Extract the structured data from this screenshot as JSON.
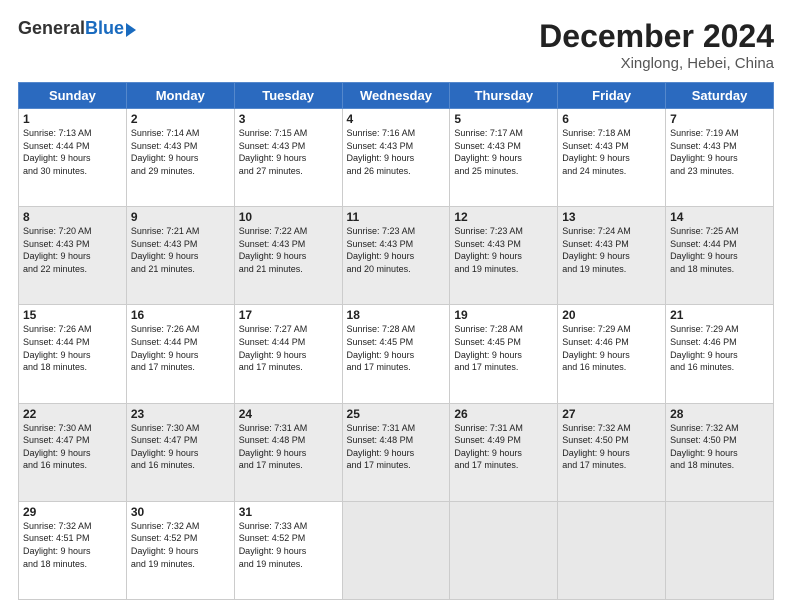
{
  "logo": {
    "general": "General",
    "blue": "Blue"
  },
  "title": "December 2024",
  "location": "Xinglong, Hebei, China",
  "days_of_week": [
    "Sunday",
    "Monday",
    "Tuesday",
    "Wednesday",
    "Thursday",
    "Friday",
    "Saturday"
  ],
  "weeks": [
    [
      {
        "day": "1",
        "info": "Sunrise: 7:13 AM\nSunset: 4:44 PM\nDaylight: 9 hours\nand 30 minutes."
      },
      {
        "day": "2",
        "info": "Sunrise: 7:14 AM\nSunset: 4:43 PM\nDaylight: 9 hours\nand 29 minutes."
      },
      {
        "day": "3",
        "info": "Sunrise: 7:15 AM\nSunset: 4:43 PM\nDaylight: 9 hours\nand 27 minutes."
      },
      {
        "day": "4",
        "info": "Sunrise: 7:16 AM\nSunset: 4:43 PM\nDaylight: 9 hours\nand 26 minutes."
      },
      {
        "day": "5",
        "info": "Sunrise: 7:17 AM\nSunset: 4:43 PM\nDaylight: 9 hours\nand 25 minutes."
      },
      {
        "day": "6",
        "info": "Sunrise: 7:18 AM\nSunset: 4:43 PM\nDaylight: 9 hours\nand 24 minutes."
      },
      {
        "day": "7",
        "info": "Sunrise: 7:19 AM\nSunset: 4:43 PM\nDaylight: 9 hours\nand 23 minutes."
      }
    ],
    [
      {
        "day": "8",
        "info": "Sunrise: 7:20 AM\nSunset: 4:43 PM\nDaylight: 9 hours\nand 22 minutes."
      },
      {
        "day": "9",
        "info": "Sunrise: 7:21 AM\nSunset: 4:43 PM\nDaylight: 9 hours\nand 21 minutes."
      },
      {
        "day": "10",
        "info": "Sunrise: 7:22 AM\nSunset: 4:43 PM\nDaylight: 9 hours\nand 21 minutes."
      },
      {
        "day": "11",
        "info": "Sunrise: 7:23 AM\nSunset: 4:43 PM\nDaylight: 9 hours\nand 20 minutes."
      },
      {
        "day": "12",
        "info": "Sunrise: 7:23 AM\nSunset: 4:43 PM\nDaylight: 9 hours\nand 19 minutes."
      },
      {
        "day": "13",
        "info": "Sunrise: 7:24 AM\nSunset: 4:43 PM\nDaylight: 9 hours\nand 19 minutes."
      },
      {
        "day": "14",
        "info": "Sunrise: 7:25 AM\nSunset: 4:44 PM\nDaylight: 9 hours\nand 18 minutes."
      }
    ],
    [
      {
        "day": "15",
        "info": "Sunrise: 7:26 AM\nSunset: 4:44 PM\nDaylight: 9 hours\nand 18 minutes."
      },
      {
        "day": "16",
        "info": "Sunrise: 7:26 AM\nSunset: 4:44 PM\nDaylight: 9 hours\nand 17 minutes."
      },
      {
        "day": "17",
        "info": "Sunrise: 7:27 AM\nSunset: 4:44 PM\nDaylight: 9 hours\nand 17 minutes."
      },
      {
        "day": "18",
        "info": "Sunrise: 7:28 AM\nSunset: 4:45 PM\nDaylight: 9 hours\nand 17 minutes."
      },
      {
        "day": "19",
        "info": "Sunrise: 7:28 AM\nSunset: 4:45 PM\nDaylight: 9 hours\nand 17 minutes."
      },
      {
        "day": "20",
        "info": "Sunrise: 7:29 AM\nSunset: 4:46 PM\nDaylight: 9 hours\nand 16 minutes."
      },
      {
        "day": "21",
        "info": "Sunrise: 7:29 AM\nSunset: 4:46 PM\nDaylight: 9 hours\nand 16 minutes."
      }
    ],
    [
      {
        "day": "22",
        "info": "Sunrise: 7:30 AM\nSunset: 4:47 PM\nDaylight: 9 hours\nand 16 minutes."
      },
      {
        "day": "23",
        "info": "Sunrise: 7:30 AM\nSunset: 4:47 PM\nDaylight: 9 hours\nand 16 minutes."
      },
      {
        "day": "24",
        "info": "Sunrise: 7:31 AM\nSunset: 4:48 PM\nDaylight: 9 hours\nand 17 minutes."
      },
      {
        "day": "25",
        "info": "Sunrise: 7:31 AM\nSunset: 4:48 PM\nDaylight: 9 hours\nand 17 minutes."
      },
      {
        "day": "26",
        "info": "Sunrise: 7:31 AM\nSunset: 4:49 PM\nDaylight: 9 hours\nand 17 minutes."
      },
      {
        "day": "27",
        "info": "Sunrise: 7:32 AM\nSunset: 4:50 PM\nDaylight: 9 hours\nand 17 minutes."
      },
      {
        "day": "28",
        "info": "Sunrise: 7:32 AM\nSunset: 4:50 PM\nDaylight: 9 hours\nand 18 minutes."
      }
    ],
    [
      {
        "day": "29",
        "info": "Sunrise: 7:32 AM\nSunset: 4:51 PM\nDaylight: 9 hours\nand 18 minutes."
      },
      {
        "day": "30",
        "info": "Sunrise: 7:32 AM\nSunset: 4:52 PM\nDaylight: 9 hours\nand 19 minutes."
      },
      {
        "day": "31",
        "info": "Sunrise: 7:33 AM\nSunset: 4:52 PM\nDaylight: 9 hours\nand 19 minutes."
      },
      {
        "day": "",
        "info": ""
      },
      {
        "day": "",
        "info": ""
      },
      {
        "day": "",
        "info": ""
      },
      {
        "day": "",
        "info": ""
      }
    ]
  ]
}
